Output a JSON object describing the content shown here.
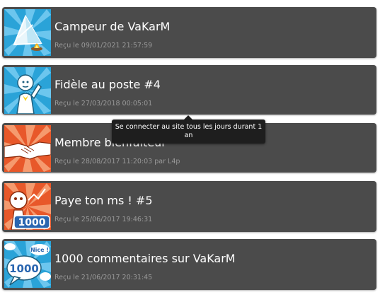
{
  "badges": [
    {
      "title": "Campeur de VaKarM",
      "date": "Reçu le 09/01/2021 21:57:59",
      "icon": "camping-tent-icon",
      "color": "#2aa3d8"
    },
    {
      "title": "Fidèle au poste #4",
      "date": "Reçu le 27/03/2018 00:05:01",
      "icon": "saluting-character-icon",
      "color": "#2aa3d8"
    },
    {
      "title": "Membre bienfaiteur",
      "date": "Reçu le 28/08/2017 11:20:03 par L4p",
      "icon": "handshake-icon",
      "color": "#e8582a"
    },
    {
      "title": "Paye ton ms ! #5",
      "date": "Reçu le 25/06/2017 19:46:31",
      "icon": "stopwatch-1000-icon",
      "color": "#e8582a"
    },
    {
      "title": "1000 commentaires sur VaKarM",
      "date": "Reçu le 21/06/2017 20:31:45",
      "icon": "speech-bubble-1000-icon",
      "color": "#2aa3d8"
    }
  ],
  "tooltip": {
    "text": "Se connecter au site tous les jours durant 1 an"
  },
  "icon_text": {
    "ms_number": "1000",
    "comments_number": "1000",
    "comments_nice": "Nice !"
  }
}
